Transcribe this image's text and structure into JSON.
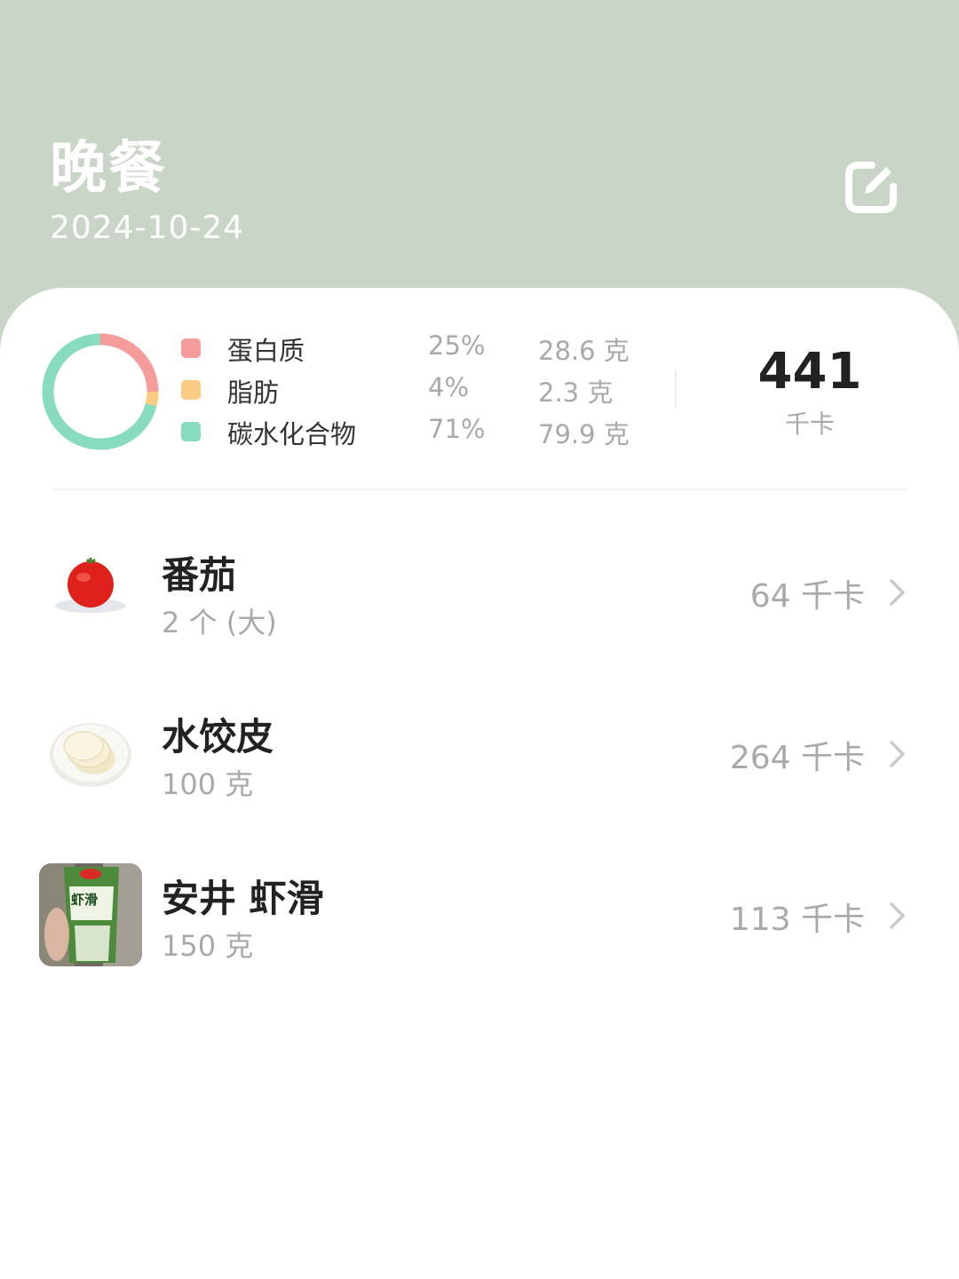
{
  "header": {
    "title": "晚餐",
    "date": "2024-10-24",
    "edit_icon": "edit-icon"
  },
  "summary": {
    "macros": [
      {
        "name": "蛋白质",
        "percent": "25%",
        "grams": "28.6 克",
        "color": "#f59c9a",
        "share": 0.25
      },
      {
        "name": "脂肪",
        "percent": "4%",
        "grams": "2.3 克",
        "color": "#fbcb84",
        "share": 0.04
      },
      {
        "name": "碳水化合物",
        "percent": "71%",
        "grams": "79.9 克",
        "color": "#86dcbc",
        "share": 0.71
      }
    ],
    "total_kcal": "441",
    "kcal_unit": "千卡"
  },
  "foods": [
    {
      "name": "番茄",
      "amount": "2 个 (大)",
      "kcal": "64 千卡",
      "image": "tomato-photo"
    },
    {
      "name": "水饺皮",
      "amount": "100 克",
      "kcal": "264 千卡",
      "image": "dumpling-wrappers-photo"
    },
    {
      "name": "安井 虾滑",
      "amount": "150 克",
      "kcal": "113 千卡",
      "image": "shrimp-paste-package-photo",
      "package_text": "虾滑"
    }
  ],
  "colors": {
    "header_bg": "#c9d5c6",
    "card_bg": "#ffffff",
    "protein": "#f59c9a",
    "fat": "#fbcb84",
    "carbs": "#86dcbc"
  }
}
